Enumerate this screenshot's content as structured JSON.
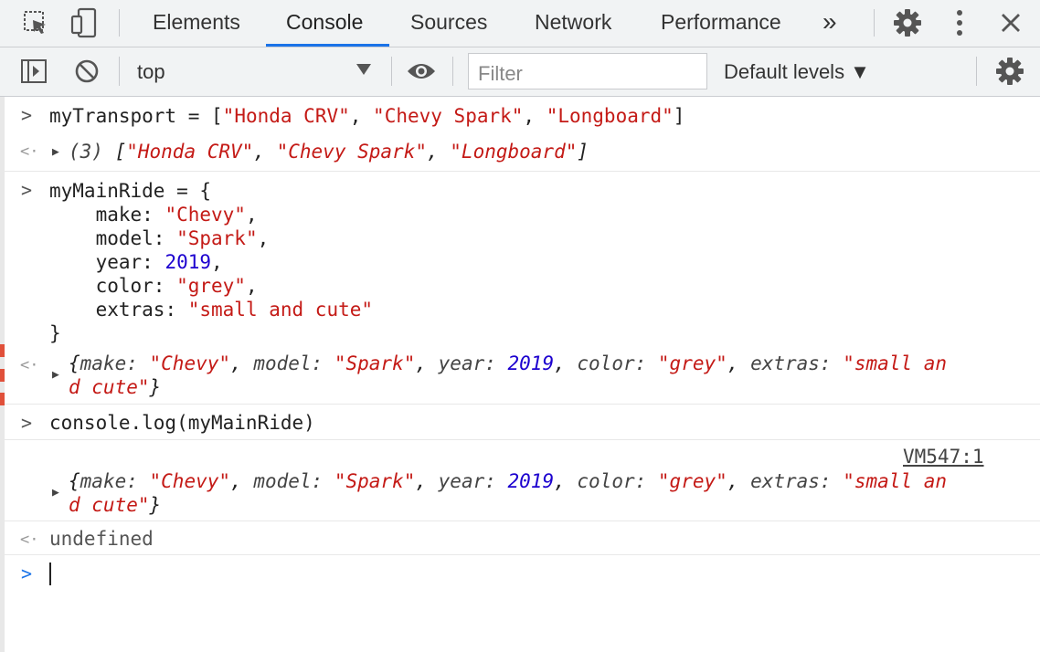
{
  "tabbar": {
    "tabs": [
      {
        "label": "Elements"
      },
      {
        "label": "Console",
        "active": true
      },
      {
        "label": "Sources"
      },
      {
        "label": "Network"
      },
      {
        "label": "Performance"
      }
    ],
    "more_label": "»",
    "accent": "#1a73e8"
  },
  "toolbar": {
    "context": "top",
    "filter_placeholder": "Filter",
    "levels_label": "Default levels ▼"
  },
  "console": {
    "entry1": {
      "input_var": "myTransport = ",
      "input_open": "[",
      "items": [
        "\"Honda CRV\"",
        "\"Chevy Spark\"",
        "\"Longboard\""
      ],
      "input_close": "]",
      "output_count": "(3) ",
      "output_open": "[",
      "output_close": "]"
    },
    "entry2": {
      "line1": "myMainRide = {",
      "props": [
        {
          "key": "make",
          "value": "\"Chevy\""
        },
        {
          "key": "model",
          "value": "\"Spark\""
        },
        {
          "key": "year",
          "value": "2019"
        },
        {
          "key": "color",
          "value": "\"grey\""
        },
        {
          "key": "extras",
          "value": "\"small and cute\""
        }
      ],
      "close": "}"
    },
    "object_output": {
      "k_make": "make: ",
      "v_make": "\"Chevy\"",
      "k_model": "model: ",
      "v_model": "\"Spark\"",
      "k_year": "year: ",
      "v_year": "2019",
      "k_color": "color: ",
      "v_color": "\"grey\"",
      "k_extras": "extras: ",
      "v_extras_line1": "\"small an",
      "v_extras_line2": "d cute\""
    },
    "entry3": {
      "input": "console.log(myMainRide)",
      "source_link": "VM547:1",
      "return_value": "undefined"
    }
  },
  "colors": {
    "string": "#c41a16",
    "number": "#1c00cf",
    "toolbar_bg": "#f1f3f4"
  }
}
